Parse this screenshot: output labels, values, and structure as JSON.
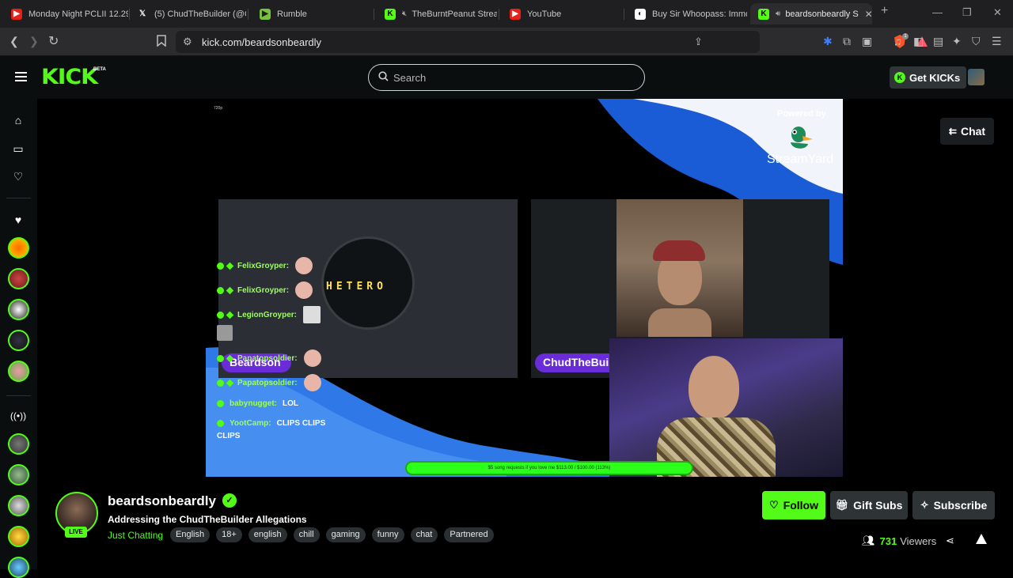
{
  "browser": {
    "tabs": [
      {
        "title": "Monday Night PCLII 12.29",
        "icon": "youtube-icon"
      },
      {
        "title": "(5) ChudTheBuilder (@Ch",
        "icon": "x-logo-icon"
      },
      {
        "title": "Rumble",
        "icon": "rumble-icon"
      },
      {
        "title": "TheBurntPeanut Strea",
        "icon": "kick-icon",
        "muted": true
      },
      {
        "title": "YouTube",
        "icon": "youtube-icon"
      },
      {
        "title": "Buy Sir Whoopass: Immo",
        "icon": "site-icon"
      },
      {
        "title": "beardsonbeardly S",
        "icon": "kick-icon",
        "active": true,
        "audio": true
      }
    ],
    "new_tab": "+",
    "url": "kick.com/beardsonbeardly",
    "brave_badge": "1"
  },
  "kick": {
    "logo": "KICK",
    "beta": "BETA",
    "search_placeholder": "Search",
    "get_kicks": "Get KICKs",
    "chat_toggle": "Chat"
  },
  "stream": {
    "resolution": "720p",
    "powered_by": "Powered by",
    "streamyard": "StreamYard",
    "overlay_text": "HETERO",
    "name_left": "Beardson",
    "name_right": "ChudTheBui",
    "progress_text": "$5 song requests if you love me $113.00 / $100.00 (113%)",
    "progress_fraction": 1.0,
    "chat": [
      {
        "user": "FelixGroyper:",
        "msg": "",
        "emote": true
      },
      {
        "user": "FelixGroyper:",
        "msg": "",
        "emote": true
      },
      {
        "user": "LegionGroyper:",
        "msg": "",
        "emote": true
      },
      {
        "user": "Papatopsoldier:",
        "msg": "",
        "emote": true
      },
      {
        "user": "Papatopsoldier:",
        "msg": "",
        "emote": true
      },
      {
        "user": "babynugget:",
        "msg": "LOL",
        "emote": false
      },
      {
        "user": "YootCamp:",
        "msg": "CLIPS CLIPS",
        "emote": false
      }
    ],
    "chat_wrap": "CLIPS"
  },
  "channel": {
    "name": "beardsonbeardly",
    "live": "LIVE",
    "title": "Addressing the ChudTheBuilder Allegations",
    "category": "Just Chatting",
    "tags": [
      "English",
      "18+",
      "english",
      "chill",
      "gaming",
      "funny",
      "chat",
      "Partnered"
    ],
    "follow": "Follow",
    "gift_subs": "Gift Subs",
    "subscribe": "Subscribe",
    "viewers": "731",
    "viewers_label": "Viewers"
  },
  "colors": {
    "kick_green": "#53fc18",
    "bg": "#000000",
    "header_bg": "#0b0e0f"
  }
}
